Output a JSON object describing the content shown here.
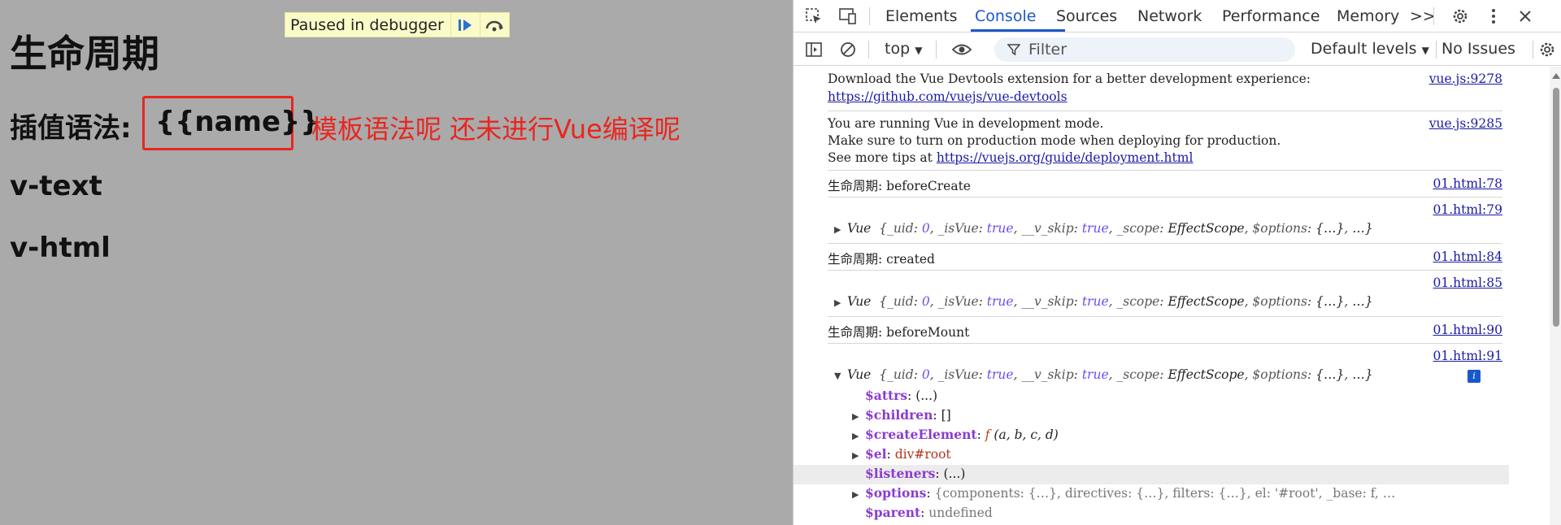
{
  "page": {
    "title": "生命周期",
    "interp_label": "插值语法:",
    "interp_value": "{{name}}",
    "annotation": "模板语法呢 还未进行Vue编译呢",
    "v_text": "v-text",
    "v_html": "v-html",
    "background": "#aaaaaa",
    "annotation_color": "#e8261f"
  },
  "debugger": {
    "label": "Paused in debugger",
    "resume_icon": "resume-icon",
    "step_over_icon": "step-over-icon"
  },
  "devtools": {
    "tabs": [
      "Elements",
      "Console",
      "Sources",
      "Network",
      "Performance",
      "Memory"
    ],
    "active_tab": "Console",
    "more_tabs": ">>",
    "accent": "#1a57c9",
    "toolbar": {
      "context": "top",
      "filter_placeholder": "Filter",
      "levels": "Default levels",
      "issues": "No Issues"
    },
    "console": {
      "messages": [
        {
          "lines": [
            "Download the Vue Devtools extension for a better development experience:"
          ],
          "link": "https://github.com/vuejs/vue-devtools",
          "source": "vue.js:9278"
        },
        {
          "lines": [
            "You are running Vue in development mode.",
            "Make sure to turn on production mode when deploying for production.",
            "See more tips at "
          ],
          "link": "https://vuejs.org/guide/deployment.html",
          "source": "vue.js:9285"
        },
        {
          "text": "生命周期: beforeCreate",
          "source": "01.html:78"
        },
        {
          "source": "01.html:79",
          "object": "Vue {_uid: 0, _isVue: true, __v_skip: true, _scope: EffectScope, $options: {…}, …}"
        },
        {
          "text": "生命周期: created",
          "source": "01.html:84"
        },
        {
          "source": "01.html:85",
          "object": "Vue {_uid: 0, _isVue: true, __v_skip: true, _scope: EffectScope, $options: {…}, …}"
        },
        {
          "text": "生命周期: beforeMount",
          "source": "01.html:90"
        },
        {
          "source": "01.html:91",
          "object": "Vue {_uid: 0, _isVue: true, __v_skip: true, _scope: EffectScope, $options: {…}, …}"
        }
      ],
      "obj_parts": {
        "name": "Vue",
        "uid_k": "_uid",
        "uid_v": "0",
        "isvue_k": "_isVue",
        "isvue_v": "true",
        "skip_k": "__v_skip",
        "skip_v": "true",
        "scope_k": "_scope",
        "scope_v": "EffectScope",
        "options_k": "$options",
        "options_v": "{…}",
        "ellipsis": "…}"
      },
      "properties": [
        {
          "key": "$attrs",
          "value": "(...)"
        },
        {
          "key": "$children",
          "value": "[]"
        },
        {
          "key": "$createElement",
          "value": "(a, b, c, d)",
          "fn": "f"
        },
        {
          "key": "$el",
          "value": "div#root"
        },
        {
          "key": "$listeners",
          "value": "(...)"
        },
        {
          "key": "$options",
          "value": "{components: {…}, directives: {…}, filters: {…}, el: '#root', _base: f, …"
        },
        {
          "key": "$parent",
          "value": "undefined"
        }
      ]
    }
  }
}
